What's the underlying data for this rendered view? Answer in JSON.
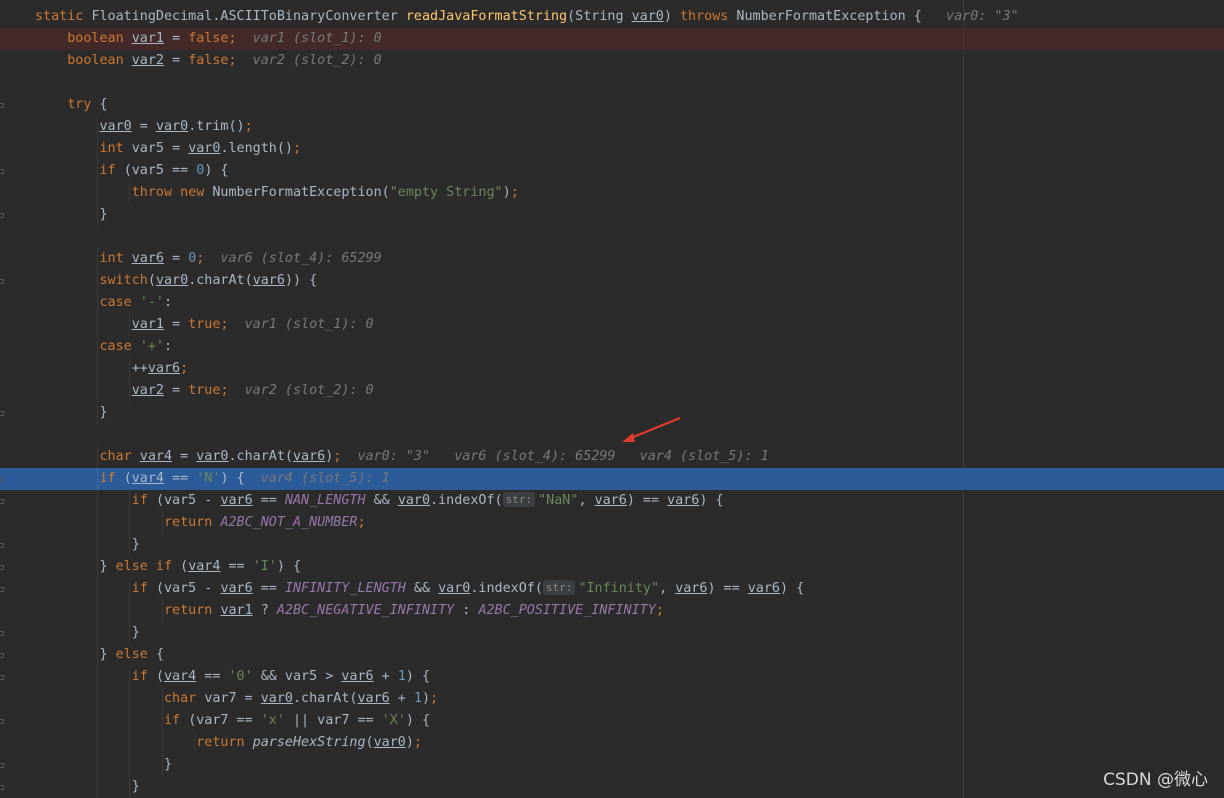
{
  "editor": {
    "theme_colors": {
      "keyword": "#cc7832",
      "method": "#ffc66d",
      "number": "#6897bb",
      "string": "#6a8759",
      "constant": "#9876aa",
      "hint": "#787878",
      "selection": "#2c5b9a"
    },
    "lines": [
      {
        "segs": [
          [
            "kw",
            "static "
          ],
          [
            "",
            "FloatingDecimal.ASCIIToBinaryConverter "
          ],
          [
            "fn",
            "readJavaFormatString"
          ],
          [
            "",
            "(String "
          ],
          [
            "u",
            "var0"
          ],
          [
            "",
            ") "
          ],
          [
            "kw",
            "throws "
          ],
          [
            "",
            "NumberFormatException {  "
          ],
          [
            "hint",
            " var0: \"3\""
          ]
        ]
      },
      {
        "exec": true,
        "segs": [
          [
            "kw",
            "    boolean "
          ],
          [
            "u",
            "var1"
          ],
          [
            "",
            " = "
          ],
          [
            "kw",
            "false"
          ],
          [
            "kw",
            ";"
          ],
          [
            "hint",
            "  var1 (slot_1): 0"
          ]
        ]
      },
      {
        "segs": [
          [
            "kw",
            "    boolean "
          ],
          [
            "u",
            "var2"
          ],
          [
            "",
            " = "
          ],
          [
            "kw",
            "false"
          ],
          [
            "kw",
            ";"
          ],
          [
            "hint",
            "  var2 (slot_2): 0"
          ]
        ]
      },
      {
        "segs": []
      },
      {
        "segs": [
          [
            "kw",
            "    try "
          ],
          [
            "",
            "{"
          ]
        ]
      },
      {
        "segs": [
          [
            "",
            "        "
          ],
          [
            "u",
            "var0"
          ],
          [
            "",
            " = "
          ],
          [
            "u",
            "var0"
          ],
          [
            "",
            ".trim()"
          ],
          [
            "kw",
            ";"
          ]
        ]
      },
      {
        "segs": [
          [
            "kw",
            "        int "
          ],
          [
            "",
            "var5 = "
          ],
          [
            "u",
            "var0"
          ],
          [
            "",
            ".length()"
          ],
          [
            "kw",
            ";"
          ]
        ]
      },
      {
        "segs": [
          [
            "kw",
            "        if "
          ],
          [
            "",
            "(var5 == "
          ],
          [
            "num",
            "0"
          ],
          [
            "",
            ") {"
          ]
        ]
      },
      {
        "segs": [
          [
            "kw",
            "            throw new "
          ],
          [
            "",
            "NumberFormatException("
          ],
          [
            "str",
            "\"empty String\""
          ],
          [
            "",
            ")"
          ],
          [
            "kw",
            ";"
          ]
        ]
      },
      {
        "segs": [
          [
            "",
            "        }"
          ]
        ]
      },
      {
        "segs": []
      },
      {
        "segs": [
          [
            "kw",
            "        int "
          ],
          [
            "u",
            "var6"
          ],
          [
            "",
            " = "
          ],
          [
            "num",
            "0"
          ],
          [
            "kw",
            ";"
          ],
          [
            "hint",
            "  var6 (slot_4): 65299"
          ]
        ]
      },
      {
        "segs": [
          [
            "kw",
            "        switch"
          ],
          [
            "",
            "("
          ],
          [
            "u",
            "var0"
          ],
          [
            "",
            ".charAt("
          ],
          [
            "u",
            "var6"
          ],
          [
            "",
            ")) {"
          ]
        ]
      },
      {
        "segs": [
          [
            "kw",
            "        case "
          ],
          [
            "str",
            "'-'"
          ],
          [
            "",
            ":"
          ]
        ]
      },
      {
        "segs": [
          [
            "",
            "            "
          ],
          [
            "u",
            "var1"
          ],
          [
            "",
            " = "
          ],
          [
            "kw",
            "true"
          ],
          [
            "kw",
            ";"
          ],
          [
            "hint",
            "  var1 (slot_1): 0"
          ]
        ]
      },
      {
        "segs": [
          [
            "kw",
            "        case "
          ],
          [
            "str",
            "'+'"
          ],
          [
            "",
            ":"
          ]
        ]
      },
      {
        "segs": [
          [
            "",
            "            ++"
          ],
          [
            "u",
            "var6"
          ],
          [
            "kw",
            ";"
          ]
        ]
      },
      {
        "segs": [
          [
            "",
            "            "
          ],
          [
            "u",
            "var2"
          ],
          [
            "",
            " = "
          ],
          [
            "kw",
            "true"
          ],
          [
            "kw",
            ";"
          ],
          [
            "hint",
            "  var2 (slot_2): 0"
          ]
        ]
      },
      {
        "segs": [
          [
            "",
            "        }"
          ]
        ]
      },
      {
        "segs": []
      },
      {
        "segs": [
          [
            "kw",
            "        char "
          ],
          [
            "u",
            "var4"
          ],
          [
            "",
            " = "
          ],
          [
            "u",
            "var0"
          ],
          [
            "",
            ".charAt("
          ],
          [
            "u",
            "var6"
          ],
          [
            "",
            ")"
          ],
          [
            "kw",
            ";"
          ],
          [
            "hint",
            "  var0: \"3\"   var6 (slot_4): 65299   var4 (slot_5): 1"
          ]
        ]
      },
      {
        "sel": true,
        "segs": [
          [
            "kw",
            "        if "
          ],
          [
            "",
            "("
          ],
          [
            "u",
            "var4"
          ],
          [
            "",
            " == "
          ],
          [
            "str",
            "'N'"
          ],
          [
            "",
            ") {"
          ],
          [
            "hint",
            "  var4 (slot_5): 1"
          ]
        ]
      },
      {
        "segs": [
          [
            "kw",
            "            if "
          ],
          [
            "",
            "(var5 - "
          ],
          [
            "u",
            "var6"
          ],
          [
            "",
            " == "
          ],
          [
            "const",
            "NAN_LENGTH"
          ],
          [
            "",
            " && "
          ],
          [
            "u",
            "var0"
          ],
          [
            "",
            ".indexOf("
          ],
          [
            "ph",
            "str:"
          ],
          [
            "str",
            "\"NaN\""
          ],
          [
            "",
            ", "
          ],
          [
            "u",
            "var6"
          ],
          [
            "",
            ") == "
          ],
          [
            "u",
            "var6"
          ],
          [
            "",
            ") {"
          ]
        ]
      },
      {
        "segs": [
          [
            "kw",
            "                return "
          ],
          [
            "const",
            "A2BC_NOT_A_NUMBER"
          ],
          [
            "kw",
            ";"
          ]
        ]
      },
      {
        "segs": [
          [
            "",
            "            }"
          ]
        ]
      },
      {
        "segs": [
          [
            "",
            "        } "
          ],
          [
            "kw",
            "else if "
          ],
          [
            "",
            "("
          ],
          [
            "u",
            "var4"
          ],
          [
            "",
            " == "
          ],
          [
            "str",
            "'I'"
          ],
          [
            "",
            ") {"
          ]
        ]
      },
      {
        "segs": [
          [
            "kw",
            "            if "
          ],
          [
            "",
            "(var5 - "
          ],
          [
            "u",
            "var6"
          ],
          [
            "",
            " == "
          ],
          [
            "const",
            "INFINITY_LENGTH"
          ],
          [
            "",
            " && "
          ],
          [
            "u",
            "var0"
          ],
          [
            "",
            ".indexOf("
          ],
          [
            "ph",
            "str:"
          ],
          [
            "str",
            "\"Infinity\""
          ],
          [
            "",
            ", "
          ],
          [
            "u",
            "var6"
          ],
          [
            "",
            ") == "
          ],
          [
            "u",
            "var6"
          ],
          [
            "",
            ") {"
          ]
        ]
      },
      {
        "segs": [
          [
            "kw",
            "                return "
          ],
          [
            "u",
            "var1"
          ],
          [
            "",
            " ? "
          ],
          [
            "const",
            "A2BC_NEGATIVE_INFINITY"
          ],
          [
            "",
            " : "
          ],
          [
            "const",
            "A2BC_POSITIVE_INFINITY"
          ],
          [
            "kw",
            ";"
          ]
        ]
      },
      {
        "segs": [
          [
            "",
            "            }"
          ]
        ]
      },
      {
        "segs": [
          [
            "",
            "        } "
          ],
          [
            "kw",
            "else "
          ],
          [
            "",
            "{"
          ]
        ]
      },
      {
        "segs": [
          [
            "kw",
            "            if "
          ],
          [
            "",
            "("
          ],
          [
            "u",
            "var4"
          ],
          [
            "",
            " == "
          ],
          [
            "str",
            "'0'"
          ],
          [
            "",
            " && var5 > "
          ],
          [
            "u",
            "var6"
          ],
          [
            "",
            " + "
          ],
          [
            "num",
            "1"
          ],
          [
            "",
            ") {"
          ]
        ]
      },
      {
        "segs": [
          [
            "kw",
            "                char "
          ],
          [
            "",
            "var7 = "
          ],
          [
            "u",
            "var0"
          ],
          [
            "",
            ".charAt("
          ],
          [
            "u",
            "var6"
          ],
          [
            "",
            " + "
          ],
          [
            "num",
            "1"
          ],
          [
            "",
            ")"
          ],
          [
            "kw",
            ";"
          ]
        ]
      },
      {
        "segs": [
          [
            "kw",
            "                if "
          ],
          [
            "",
            "(var7 == "
          ],
          [
            "str",
            "'x'"
          ],
          [
            "",
            " || var7 == "
          ],
          [
            "str",
            "'X'"
          ],
          [
            "",
            ") {"
          ]
        ]
      },
      {
        "segs": [
          [
            "kw",
            "                    return "
          ],
          [
            "sfn",
            "parseHexString"
          ],
          [
            "",
            "("
          ],
          [
            "u",
            "var0"
          ],
          [
            "",
            ")"
          ],
          [
            "kw",
            ";"
          ]
        ]
      },
      {
        "segs": [
          [
            "",
            "                }"
          ]
        ]
      },
      {
        "segs": [
          [
            "",
            "            }"
          ]
        ]
      }
    ]
  },
  "watermark": "CSDN @微心"
}
